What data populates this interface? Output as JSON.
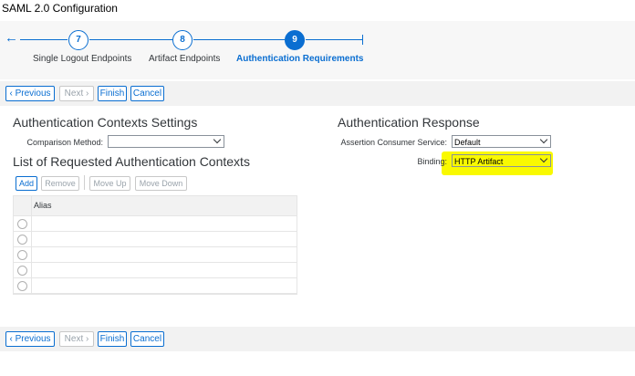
{
  "window": {
    "title": "SAML 2.0 Configuration"
  },
  "wizard": {
    "steps": [
      {
        "number": "7",
        "label": "Single Logout Endpoints"
      },
      {
        "number": "8",
        "label": "Artifact Endpoints"
      },
      {
        "number": "9",
        "label": "Authentication Requirements",
        "active": true
      }
    ]
  },
  "nav": {
    "previous": "Previous",
    "next": "Next",
    "finish": "Finish",
    "cancel": "Cancel"
  },
  "auth_contexts": {
    "title": "Authentication Contexts Settings",
    "comparison_label": "Comparison Method:",
    "comparison_value": ""
  },
  "requested_contexts": {
    "title": "List of Requested Authentication Contexts",
    "buttons": {
      "add": "Add",
      "remove": "Remove",
      "move_up": "Move Up",
      "move_down": "Move Down"
    },
    "columns": [
      "Alias"
    ],
    "rows": [
      "",
      "",
      "",
      "",
      ""
    ]
  },
  "auth_response": {
    "title": "Authentication Response",
    "acs_label": "Assertion Consumer Service:",
    "acs_value": "Default",
    "binding_label": "Binding:",
    "binding_value": "HTTP Artifact"
  },
  "colors": {
    "accent": "#0a6ed1",
    "highlight": "#f9f900"
  },
  "icons": {
    "back": "arrow-left-icon",
    "dropdown": "chevron-down-icon",
    "next": "chevron-right-icon",
    "previous": "chevron-left-icon"
  }
}
